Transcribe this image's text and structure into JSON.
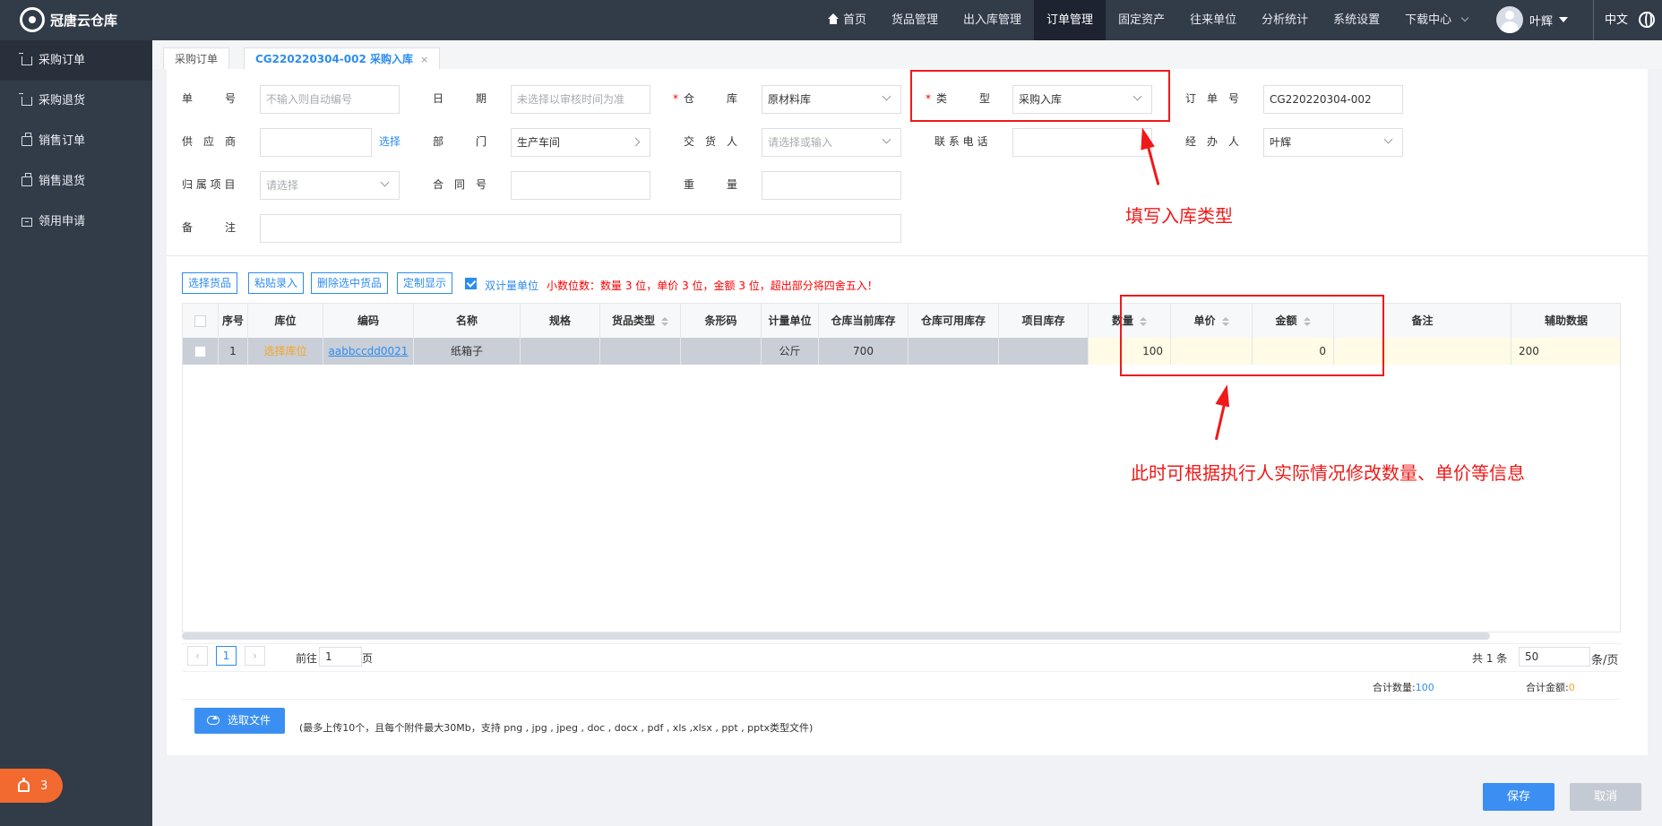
{
  "app": {
    "title": "冠唐云仓库",
    "nav": [
      "首页",
      "货品管理",
      "出入库管理",
      "订单管理",
      "固定资产",
      "往来单位",
      "分析统计",
      "系统设置",
      "下载中心"
    ],
    "active_nav": "订单管理",
    "user": "叶辉",
    "language": "中文"
  },
  "sidebar": {
    "items": [
      {
        "label": "采购订单"
      },
      {
        "label": "采购退货"
      },
      {
        "label": "销售订单"
      },
      {
        "label": "销售退货"
      },
      {
        "label": "领用申请"
      }
    ],
    "notice_count": "3"
  },
  "tabs": [
    {
      "label": "采购订单"
    },
    {
      "label": "CG220220304-002 采购入库"
    }
  ],
  "form": {
    "order_no_label": "单　　　号",
    "order_no_placeholder": "不输入则自动编号",
    "date_label": "日　　　期",
    "date_placeholder": "未选择以审核时间为准",
    "warehouse_label": "仓　　　库",
    "warehouse_value": "原材料库",
    "type_label": "类　　　型",
    "type_value": "采购入库",
    "purchase_order_label": "订　单　号",
    "purchase_order_value": "CG220220304-002",
    "supplier_label": "供　应　商",
    "select_link": "选择",
    "department_label": "部　　　门",
    "department_value": "生产车间",
    "deliverer_label": "交　货　人",
    "deliverer_placeholder": "请选择或输入",
    "contact_phone_label": "联 系 电 话",
    "handler_label": "经　办　人",
    "handler_value": "叶辉",
    "project_label": "归 属 项 目",
    "project_placeholder": "请选择",
    "contract_label": "合　同　号",
    "weight_label": "重　　　量",
    "remark_label": "备　　　注"
  },
  "toolbar": {
    "select_goods": "选择货品",
    "paste_entry": "粘贴录入",
    "delete_selected": "删除选中货品",
    "custom_display": "定制显示",
    "dual_unit": "双计量单位",
    "decimal_note": "小数位数：数量 3 位，单价 3 位，金额 3 位，超出部分将四舍五入！"
  },
  "table": {
    "headers": [
      "序号",
      "库位",
      "编码",
      "名称",
      "规格",
      "货品类型",
      "条形码",
      "计量单位",
      "仓库当前库存",
      "仓库可用库存",
      "项目库存",
      "数量",
      "单价",
      "金额",
      "备注",
      "辅助数据"
    ],
    "rows": [
      {
        "seq": "1",
        "location": "选择库位",
        "code": "aabbccdd0021",
        "name": "纸箱子",
        "spec": "",
        "goods_type": "",
        "barcode": "",
        "unit": "公斤",
        "current_stock": "700",
        "available_stock": "",
        "project_stock": "",
        "quantity": "100",
        "unit_price": "",
        "amount": "0",
        "remark": "",
        "aux": "200"
      }
    ]
  },
  "pagination": {
    "current_page": "1",
    "goto_label": "前往",
    "goto_value": "1",
    "page_suffix": "页",
    "total_text": "共 1 条",
    "page_size": "50",
    "page_size_suffix": "条/页"
  },
  "summary": {
    "total_qty_label": "合计数量:",
    "total_qty": "100",
    "total_amount_label": "合计金额:",
    "total_amount": "0"
  },
  "upload": {
    "button": "选取文件",
    "hint": "(最多上传10个，且每个附件最大30Mb，支持 png , jpg , jpeg , doc , docx , pdf , xls ,xlsx , ppt , pptx类型文件)"
  },
  "actions": {
    "save": "保存",
    "cancel": "取消"
  },
  "annotations": {
    "type_note": "填写入库类型",
    "edit_note": "此时可根据执行人实际情况修改数量、单价等信息"
  },
  "colors": {
    "topbar": "#323b48",
    "accent": "#2d8cf0",
    "annotation": "#f01919",
    "editable_cell": "#fffbe6"
  }
}
